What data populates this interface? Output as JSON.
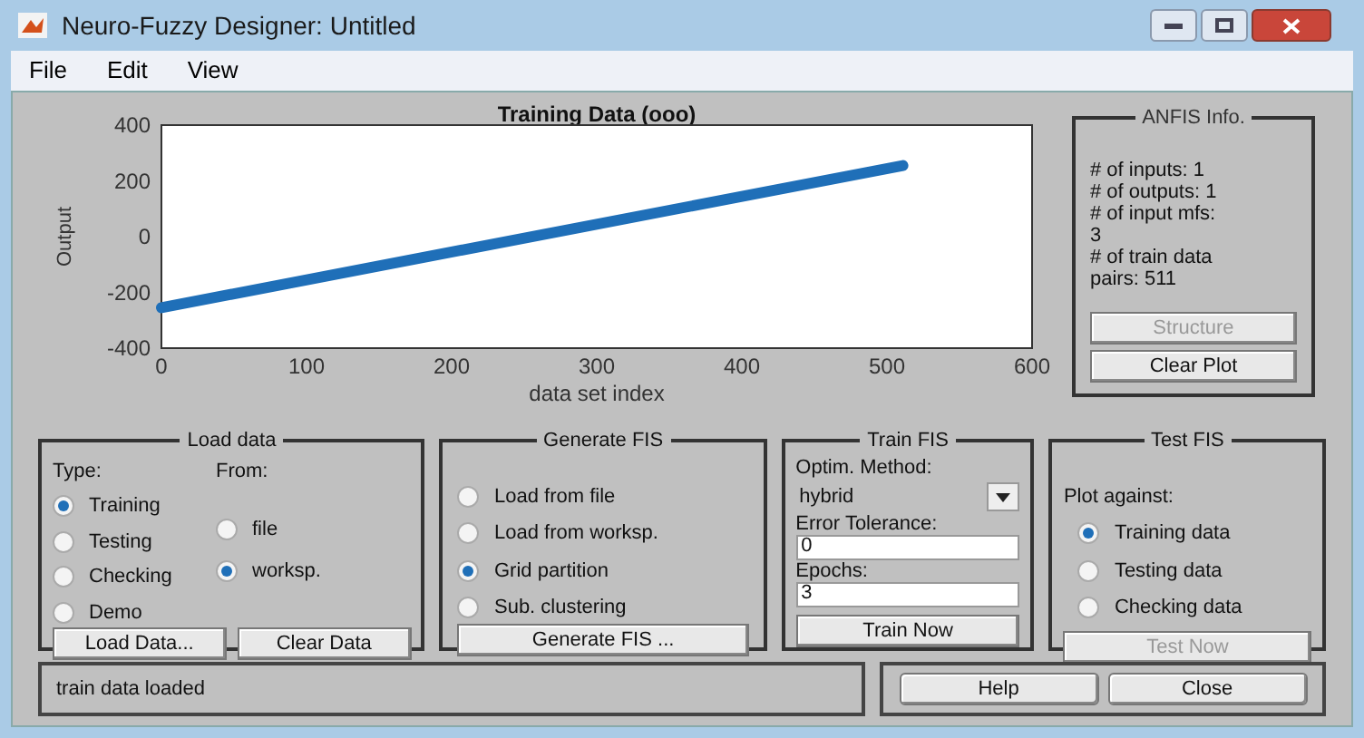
{
  "window": {
    "title": "Neuro-Fuzzy Designer: Untitled"
  },
  "menu": [
    "File",
    "Edit",
    "View"
  ],
  "plot": {
    "chart_data": {
      "type": "line",
      "title": "Training Data (ooo)",
      "xlabel": "data set index",
      "ylabel": "Output",
      "x": [
        0,
        511
      ],
      "series": [
        {
          "color": "#1f6fb8",
          "values": [
            -255,
            255
          ]
        }
      ],
      "xlim": [
        0,
        600
      ],
      "ylim": [
        -400,
        400
      ],
      "xticks": [
        0,
        100,
        200,
        300,
        400,
        500,
        600
      ],
      "yticks": [
        -400,
        -200,
        0,
        200,
        400
      ]
    }
  },
  "anfis_info": {
    "title": "ANFIS Info.",
    "lines": [
      "# of inputs: 1",
      "# of outputs: 1",
      "# of input mfs:",
      "3",
      "# of train data",
      "pairs: 511"
    ],
    "buttons": [
      {
        "label": "Structure",
        "disabled": true
      },
      {
        "label": "Clear Plot",
        "disabled": false
      }
    ]
  },
  "load_data": {
    "title": "Load data",
    "type_label": "Type:",
    "from_label": "From:",
    "types": [
      {
        "label": "Training",
        "selected": true
      },
      {
        "label": "Testing",
        "selected": false
      },
      {
        "label": "Checking",
        "selected": false
      },
      {
        "label": "Demo",
        "selected": false
      }
    ],
    "sources": [
      {
        "label": "file",
        "selected": false
      },
      {
        "label": "worksp.",
        "selected": true
      }
    ],
    "buttons": [
      {
        "label": "Load Data...",
        "disabled": false
      },
      {
        "label": "Clear Data",
        "disabled": false
      }
    ]
  },
  "generate_fis": {
    "title": "Generate FIS",
    "options": [
      {
        "label": "Load from file",
        "selected": false
      },
      {
        "label": "Load from worksp.",
        "selected": false
      },
      {
        "label": "Grid partition",
        "selected": true
      },
      {
        "label": "Sub. clustering",
        "selected": false
      }
    ],
    "button": {
      "label": "Generate FIS ...",
      "disabled": false
    }
  },
  "train_fis": {
    "title": "Train FIS",
    "method_label": "Optim. Method:",
    "method": "hybrid",
    "tolerance_label": "Error Tolerance:",
    "tolerance": "0",
    "epochs_label": "Epochs:",
    "epochs": "3",
    "button": {
      "label": "Train Now",
      "disabled": false
    }
  },
  "test_fis": {
    "title": "Test FIS",
    "plot_against_label": "Plot against:",
    "options": [
      {
        "label": "Training data",
        "selected": true
      },
      {
        "label": "Testing data",
        "selected": false
      },
      {
        "label": "Checking data",
        "selected": false
      }
    ],
    "button": {
      "label": "Test Now",
      "disabled": true
    }
  },
  "status_bar": "train data loaded",
  "buttons": [
    "Help",
    "Close"
  ]
}
